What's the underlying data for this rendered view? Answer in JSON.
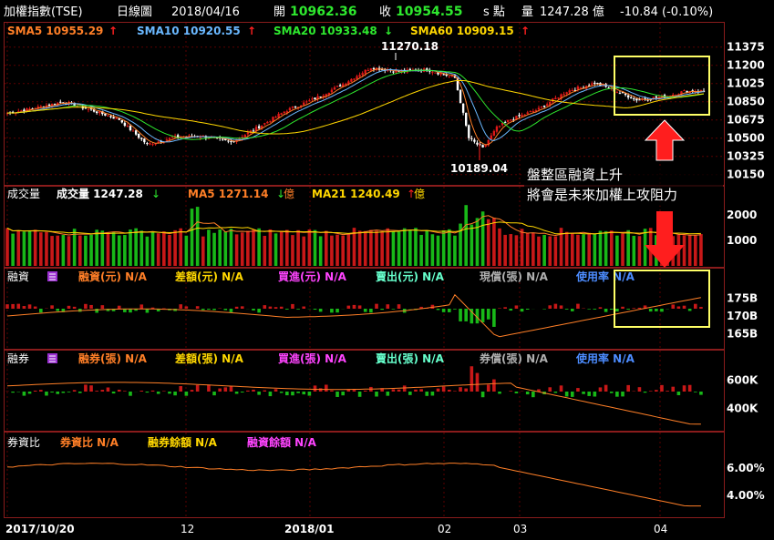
{
  "header": {
    "title": "加權指數(TSE)",
    "period": "日線圖",
    "date": "2018/04/16",
    "open_label": "開",
    "open": "10962.36",
    "close_label": "收",
    "close": "10954.55",
    "unit": "s 點",
    "vol_label": "量",
    "vol": "1247.28 億",
    "change": "-10.84 (-0.10%)"
  },
  "legends": {
    "sma5": "SMA5 10955.29",
    "sma10": "SMA10 10920.55",
    "sma20": "SMA20 10933.48",
    "sma60": "SMA60 10909.15",
    "vol_title": "成交量",
    "vol_value": "成交量 1247.28",
    "vol_ma5": "MA5 1271.14",
    "vol_ma21": "MA21 1240.49",
    "yi": "億",
    "margin_title": "融資",
    "margin_items": [
      "融資(元) N/A",
      "差額(元) N/A",
      "買進(元) N/A",
      "賣出(元) N/A",
      "現償(張) N/A",
      "使用率 N/A"
    ],
    "short_title": "融券",
    "short_items": [
      "融券(張) N/A",
      "差額(張) N/A",
      "買進(張) N/A",
      "賣出(張) N/A",
      "券償(張) N/A",
      "使用率 N/A"
    ],
    "ratio_title": "券資比",
    "ratio_items": [
      "券資比 N/A",
      "融券餘額 N/A",
      "融資餘額 N/A"
    ]
  },
  "annotations": {
    "high": "11270.18",
    "low": "10189.04",
    "note_line1": "盤整區融資上升",
    "note_line2": "將會是未來加權上攻阻力"
  },
  "colors": {
    "up": "#e01818",
    "down": "#18c818",
    "sma5": "#ff7f27",
    "sma10": "#6ab8ff",
    "sma20": "#2ee82e",
    "sma60": "#ffd700",
    "grid": "#5a0000",
    "highlight": "#ffff66",
    "arrow": "#ff2020",
    "orange_line": "#ff7f27"
  },
  "chart_data": [
    {
      "type": "candlestick",
      "title": "加權指數(TSE)",
      "xlabel": "",
      "ylabel": "",
      "x_ticks": [
        "2017/10/20",
        "12",
        "2018/01",
        "02",
        "03",
        "04"
      ],
      "y_ticks": [
        10150,
        10325,
        10500,
        10675,
        10850,
        11025,
        11200,
        11375
      ],
      "ylim": [
        10060,
        11460
      ],
      "grid": true,
      "approx_trend_points": [
        [
          0,
          10740
        ],
        [
          10,
          10790
        ],
        [
          20,
          10850
        ],
        [
          30,
          10770
        ],
        [
          40,
          10680
        ],
        [
          50,
          10440
        ],
        [
          60,
          10510
        ],
        [
          70,
          10520
        ],
        [
          80,
          10460
        ],
        [
          90,
          10610
        ],
        [
          100,
          10770
        ],
        [
          110,
          10880
        ],
        [
          120,
          11020
        ],
        [
          130,
          11180
        ],
        [
          140,
          11140
        ],
        [
          150,
          11160
        ],
        [
          160,
          11080
        ],
        [
          165,
          10500
        ],
        [
          170,
          10400
        ],
        [
          175,
          10600
        ],
        [
          180,
          10680
        ],
        [
          190,
          10780
        ],
        [
          200,
          10950
        ],
        [
          210,
          11030
        ],
        [
          215,
          10980
        ],
        [
          225,
          10870
        ],
        [
          235,
          10900
        ],
        [
          242,
          10950
        ],
        [
          249,
          10954
        ]
      ],
      "annotated_high": 11270.18,
      "annotated_low": 10189.04
    },
    {
      "type": "bar",
      "title": "成交量",
      "y_ticks": [
        1000,
        2000
      ],
      "ylim": [
        0,
        2500
      ],
      "last_value": 1247.28,
      "ma5": 1271.14,
      "ma21": 1240.49
    },
    {
      "type": "bar",
      "title": "融資",
      "y_ticks": [
        "165B",
        "170B",
        "175B"
      ],
      "ylim": [
        161,
        179
      ]
    },
    {
      "type": "bar",
      "title": "融券",
      "y_ticks": [
        "400K",
        "600K"
      ],
      "ylim": [
        250,
        700
      ]
    },
    {
      "type": "line",
      "title": "券資比",
      "y_ticks": [
        "4.00%",
        "6.00%"
      ],
      "ylim": [
        2.5,
        7.5
      ]
    }
  ]
}
